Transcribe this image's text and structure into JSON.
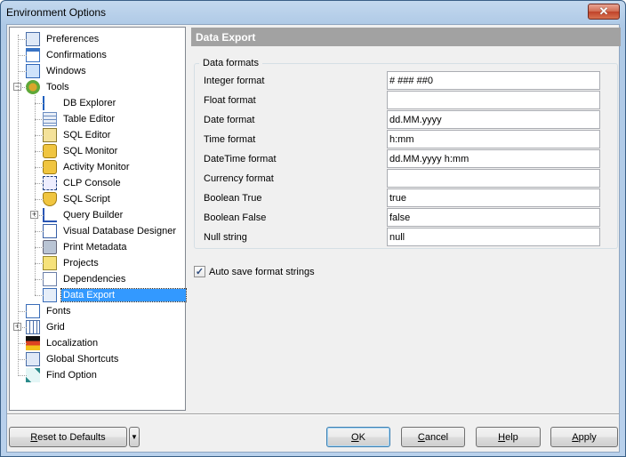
{
  "window": {
    "title": "Environment Options",
    "close_label": "✕"
  },
  "tree": {
    "items": [
      {
        "label": "Preferences",
        "icon": "preferences-icon"
      },
      {
        "label": "Confirmations",
        "icon": "confirmations-icon"
      },
      {
        "label": "Windows",
        "icon": "windows-icon"
      },
      {
        "label": "Tools",
        "icon": "tools-icon",
        "expanded": true
      },
      {
        "label": "DB Explorer",
        "icon": "db-explorer-icon"
      },
      {
        "label": "Table Editor",
        "icon": "table-editor-icon"
      },
      {
        "label": "SQL Editor",
        "icon": "sql-editor-icon"
      },
      {
        "label": "SQL Monitor",
        "icon": "sql-monitor-icon"
      },
      {
        "label": "Activity Monitor",
        "icon": "activity-monitor-icon"
      },
      {
        "label": "CLP Console",
        "icon": "clp-console-icon"
      },
      {
        "label": "SQL Script",
        "icon": "sql-script-icon"
      },
      {
        "label": "Query Builder",
        "icon": "query-builder-icon",
        "expandable": true
      },
      {
        "label": "Visual Database Designer",
        "icon": "visual-database-designer-icon"
      },
      {
        "label": "Print Metadata",
        "icon": "printer-icon"
      },
      {
        "label": "Projects",
        "icon": "projects-icon"
      },
      {
        "label": "Dependencies",
        "icon": "dependencies-icon"
      },
      {
        "label": "Data Export",
        "icon": "data-export-icon",
        "selected": true
      },
      {
        "label": "Fonts",
        "icon": "fonts-icon"
      },
      {
        "label": "Grid",
        "icon": "grid-icon",
        "expandable": true
      },
      {
        "label": "Localization",
        "icon": "localization-icon"
      },
      {
        "label": "Global Shortcuts",
        "icon": "global-shortcuts-icon"
      },
      {
        "label": "Find Option",
        "icon": "find-option-icon"
      }
    ]
  },
  "panel": {
    "header": "Data Export",
    "group_title": "Data formats",
    "fields": [
      {
        "label": "Integer format",
        "value": "# ### ##0"
      },
      {
        "label": "Float format",
        "value": ""
      },
      {
        "label": "Date format",
        "value": "dd.MM.yyyy"
      },
      {
        "label": "Time format",
        "value": "h:mm"
      },
      {
        "label": "DateTime format",
        "value": "dd.MM.yyyy h:mm"
      },
      {
        "label": "Currency format",
        "value": ""
      },
      {
        "label": "Boolean True",
        "value": "true"
      },
      {
        "label": "Boolean False",
        "value": "false"
      },
      {
        "label": "Null string",
        "value": "null"
      }
    ],
    "auto_save": {
      "label": "Auto save format strings",
      "checked": true
    }
  },
  "buttons": {
    "reset": {
      "mnemonic": "R",
      "rest": "eset to Defaults"
    },
    "ok": {
      "mnemonic": "O",
      "rest": "K"
    },
    "cancel": {
      "mnemonic": "C",
      "rest": "ancel"
    },
    "help": {
      "mnemonic": "H",
      "rest": "elp"
    },
    "apply": {
      "mnemonic": "A",
      "rest": "pply"
    }
  }
}
